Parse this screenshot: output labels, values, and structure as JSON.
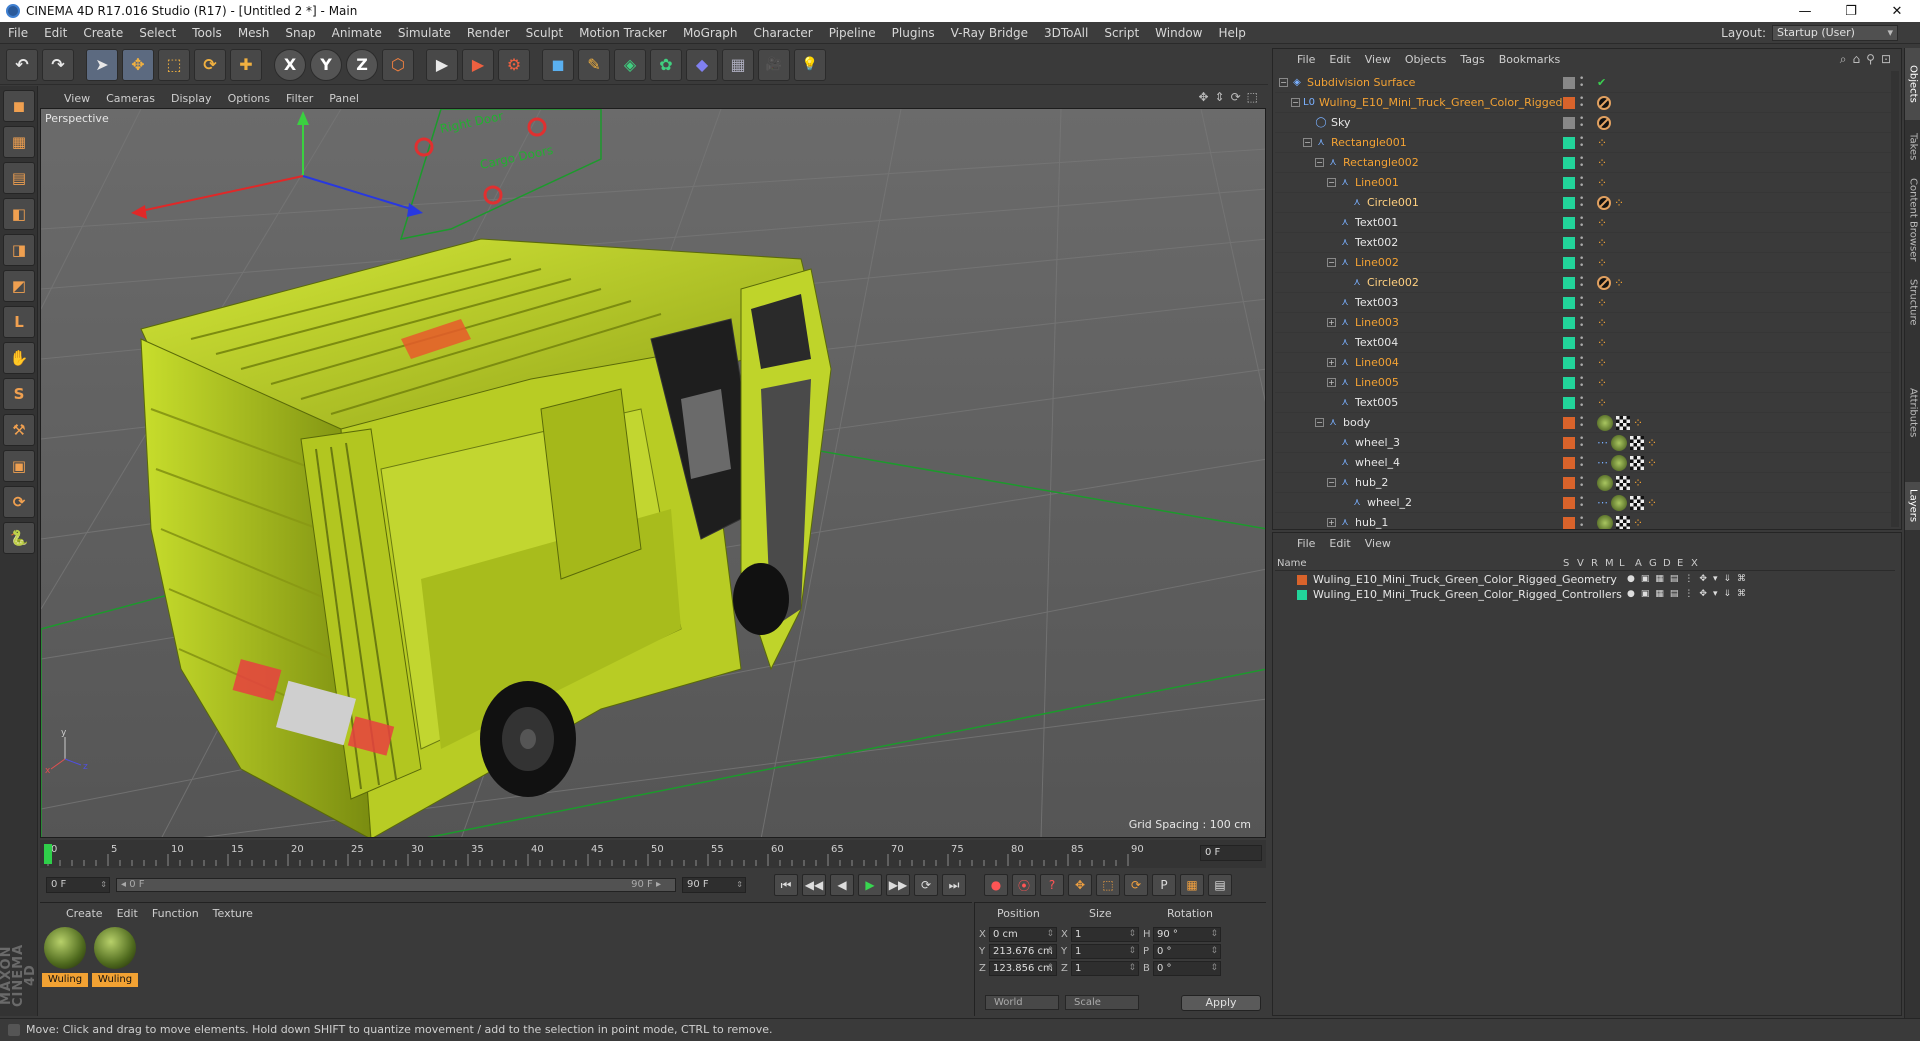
{
  "window": {
    "title": "CINEMA 4D R17.016 Studio (R17) - [Untitled 2 *] - Main",
    "min": "—",
    "max": "❐",
    "close": "✕"
  },
  "menu": [
    "File",
    "Edit",
    "Create",
    "Select",
    "Tools",
    "Mesh",
    "Snap",
    "Animate",
    "Simulate",
    "Render",
    "Sculpt",
    "Motion Tracker",
    "MoGraph",
    "Character",
    "Pipeline",
    "Plugins",
    "V-Ray Bridge",
    "3DToAll",
    "Script",
    "Window",
    "Help"
  ],
  "layout": {
    "label": "Layout:",
    "value": "Startup (User)"
  },
  "toolbar": {
    "undo": "↶",
    "redo": "↷",
    "select": "➤",
    "move": "✥",
    "scale": "⬚",
    "rotate": "⟳",
    "move2": "✚",
    "x": "X",
    "y": "Y",
    "z": "Z",
    "coord": "⬡",
    "render_view": "▶",
    "render_pic": "▶",
    "render_settings": "⚙",
    "cube": "◼",
    "pen": "✎",
    "subdiv": "◈",
    "array": "✿",
    "deformer": "◆",
    "floor": "▦",
    "camera": "🎥",
    "light": "💡"
  },
  "left_tools": [
    "◼",
    "▦",
    "▤",
    "◧",
    "◨",
    "◩",
    "L",
    "✋",
    "S",
    "⚒",
    "▣",
    "⟳",
    "🐍"
  ],
  "brand": "MAXON CINEMA 4D",
  "viewport": {
    "menu": [
      "View",
      "Cameras",
      "Display",
      "Options",
      "Filter",
      "Panel"
    ],
    "nav_icons": [
      "✥",
      "⇕",
      "⟳",
      "⬚"
    ],
    "label": "Perspective",
    "grid_spacing": "Grid Spacing : 100 cm",
    "sign_texts": [
      "Right Door",
      "Cargo Doors"
    ],
    "axis_x": "x",
    "axis_y": "y",
    "axis_z": "z"
  },
  "timeline": {
    "ticks": [
      "0",
      "5",
      "10",
      "15",
      "20",
      "25",
      "30",
      "35",
      "40",
      "45",
      "50",
      "55",
      "60",
      "65",
      "70",
      "75",
      "80",
      "85",
      "90"
    ],
    "current_frame": "0 F"
  },
  "transport": {
    "start": "0 F",
    "slider_start": "◂ 0 F",
    "slider_end": "90 F ▸",
    "end": "90 F",
    "buttons": [
      "⏮",
      "◀◀",
      "◀",
      "▶",
      "▶▶",
      "⟳",
      "⏭"
    ],
    "key_buttons": [
      "●",
      "⦿",
      "?",
      "✥",
      "⬚",
      "⟳",
      "P",
      "▦",
      "▤"
    ]
  },
  "materials": {
    "menu": [
      "Create",
      "Edit",
      "Function",
      "Texture"
    ],
    "items": [
      {
        "label": "Wuling"
      },
      {
        "label": "Wuling"
      }
    ]
  },
  "coords": {
    "headers": {
      "position": "Position",
      "size": "Size",
      "rotation": "Rotation"
    },
    "rows": [
      {
        "axis": "X",
        "pos": "0 cm",
        "size_axis": "X",
        "size": "1",
        "rot_axis": "H",
        "rot": "90 °"
      },
      {
        "axis": "Y",
        "pos": "213.676 cm",
        "size_axis": "Y",
        "size": "1",
        "rot_axis": "P",
        "rot": "0 °"
      },
      {
        "axis": "Z",
        "pos": "123.856 cm",
        "size_axis": "Z",
        "size": "1",
        "rot_axis": "B",
        "rot": "0 °"
      }
    ],
    "world": "World",
    "scale": "Scale",
    "apply": "Apply"
  },
  "status": "Move: Click and drag to move elements. Hold down SHIFT to quantize movement / add to the selection in point mode, CTRL to remove.",
  "objects": {
    "menu": [
      "File",
      "Edit",
      "View",
      "Objects",
      "Tags",
      "Bookmarks"
    ],
    "icons": [
      "⌕",
      "⌂",
      "⚲",
      "⊡"
    ],
    "tree": [
      {
        "name": "Subdivision Surface",
        "depth": 0,
        "exp": "−",
        "icon": "◈",
        "color": "orange",
        "layer": "#888888",
        "tags": "check"
      },
      {
        "name": "Wuling_E10_Mini_Truck_Green_Color_Rigged",
        "depth": 1,
        "exp": "−",
        "icon": "L0",
        "color": "orange",
        "layer": "#d9632b",
        "tags": "none"
      },
      {
        "name": "Sky",
        "depth": 2,
        "exp": "",
        "icon": "◯",
        "color": "white",
        "layer": "#888888",
        "tags": "none"
      },
      {
        "name": "Rectangle001",
        "depth": 2,
        "exp": "−",
        "icon": "⋏",
        "color": "orange",
        "layer": "#22d49a",
        "tags": "dots"
      },
      {
        "name": "Rectangle002",
        "depth": 3,
        "exp": "−",
        "icon": "⋏",
        "color": "orange",
        "layer": "#22d49a",
        "tags": "dots"
      },
      {
        "name": "Line001",
        "depth": 4,
        "exp": "−",
        "icon": "⋏",
        "color": "orange",
        "layer": "#22d49a",
        "tags": "dots"
      },
      {
        "name": "Circle001",
        "depth": 5,
        "exp": "",
        "icon": "⋏",
        "color": "selected",
        "layer": "#22d49a",
        "tags": "no-dots"
      },
      {
        "name": "Text001",
        "depth": 4,
        "exp": "",
        "icon": "⋏",
        "color": "white",
        "layer": "#22d49a",
        "tags": "dots"
      },
      {
        "name": "Text002",
        "depth": 4,
        "exp": "",
        "icon": "⋏",
        "color": "white",
        "layer": "#22d49a",
        "tags": "dots"
      },
      {
        "name": "Line002",
        "depth": 4,
        "exp": "−",
        "icon": "⋏",
        "color": "orange",
        "layer": "#22d49a",
        "tags": "dots"
      },
      {
        "name": "Circle002",
        "depth": 5,
        "exp": "",
        "icon": "⋏",
        "color": "selected",
        "layer": "#22d49a",
        "tags": "no-dots"
      },
      {
        "name": "Text003",
        "depth": 4,
        "exp": "",
        "icon": "⋏",
        "color": "white",
        "layer": "#22d49a",
        "tags": "dots"
      },
      {
        "name": "Line003",
        "depth": 4,
        "exp": "+",
        "icon": "⋏",
        "color": "orange",
        "layer": "#22d49a",
        "tags": "dots"
      },
      {
        "name": "Text004",
        "depth": 4,
        "exp": "",
        "icon": "⋏",
        "color": "white",
        "layer": "#22d49a",
        "tags": "dots"
      },
      {
        "name": "Line004",
        "depth": 4,
        "exp": "+",
        "icon": "⋏",
        "color": "orange",
        "layer": "#22d49a",
        "tags": "dots"
      },
      {
        "name": "Line005",
        "depth": 4,
        "exp": "+",
        "icon": "⋏",
        "color": "orange",
        "layer": "#22d49a",
        "tags": "dots"
      },
      {
        "name": "Text005",
        "depth": 4,
        "exp": "",
        "icon": "⋏",
        "color": "white",
        "layer": "#22d49a",
        "tags": "dots"
      },
      {
        "name": "body",
        "depth": 3,
        "exp": "−",
        "icon": "⋏",
        "color": "white",
        "layer": "#d9632b",
        "tags": "mat-chk-dots"
      },
      {
        "name": "wheel_3",
        "depth": 4,
        "exp": "",
        "icon": "⋏",
        "color": "white",
        "layer": "#d9632b",
        "tags": "bone-mat-chk-dots"
      },
      {
        "name": "wheel_4",
        "depth": 4,
        "exp": "",
        "icon": "⋏",
        "color": "white",
        "layer": "#d9632b",
        "tags": "bone-mat-chk-dots"
      },
      {
        "name": "hub_2",
        "depth": 4,
        "exp": "−",
        "icon": "⋏",
        "color": "white",
        "layer": "#d9632b",
        "tags": "mat-chk-dots"
      },
      {
        "name": "wheel_2",
        "depth": 5,
        "exp": "",
        "icon": "⋏",
        "color": "white",
        "layer": "#d9632b",
        "tags": "bone-mat-chk-dots"
      },
      {
        "name": "hub_1",
        "depth": 4,
        "exp": "+",
        "icon": "⋏",
        "color": "white",
        "layer": "#d9632b",
        "tags": "mat-chk-dots"
      }
    ]
  },
  "layers": {
    "menu": [
      "File",
      "Edit",
      "View"
    ],
    "columns": [
      "Name",
      "S",
      "V",
      "R",
      "M",
      "L",
      "A",
      "G",
      "D",
      "E",
      "X"
    ],
    "items": [
      {
        "name": "Wuling_E10_Mini_Truck_Green_Color_Rigged_Geometry",
        "color": "#d9632b"
      },
      {
        "name": "Wuling_E10_Mini_Truck_Green_Color_Rigged_Controllers",
        "color": "#22d49a"
      }
    ]
  },
  "side_tabs": [
    "Objects",
    "Takes",
    "Content Browser",
    "Structure",
    "Attributes",
    "Layers"
  ]
}
